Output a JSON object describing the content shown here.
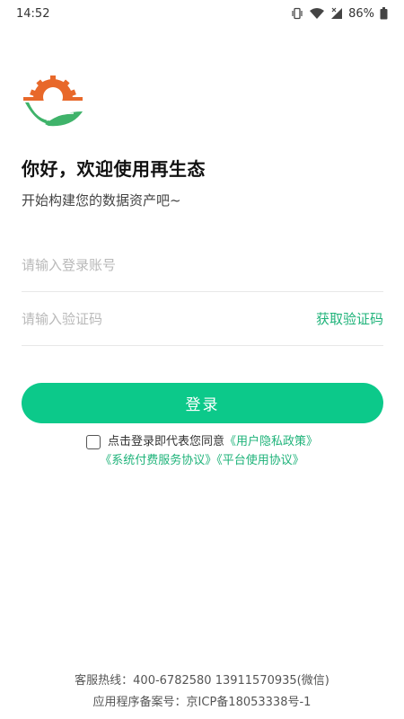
{
  "status_bar": {
    "time": "14:52",
    "battery": "86%"
  },
  "icons": {
    "vibrate": "vibrate-icon",
    "wifi": "wifi-icon",
    "signal": "signal-icon",
    "battery": "battery-icon",
    "logo": "sun-leaf-logo"
  },
  "colors": {
    "accent": "#0cc98a",
    "link": "#1fb37a",
    "logo_orange": "#e8682a",
    "logo_green": "#3fb36a"
  },
  "header": {
    "title": "你好，欢迎使用再生态",
    "subtitle": "开始构建您的数据资产吧~"
  },
  "form": {
    "account_placeholder": "请输入登录账号",
    "account_value": "",
    "code_placeholder": "请输入验证码",
    "code_value": "",
    "get_code_label": "获取验证码",
    "login_label": "登录"
  },
  "agreement": {
    "checked": false,
    "prefix": "点击登录即代表您同意",
    "privacy_link": "《用户隐私政策》",
    "payment_link": "《系统付费服务协议》",
    "platform_link": "《平台使用协议》"
  },
  "footer": {
    "hotline": "客服热线：400-6782580 13911570935(微信)",
    "icp": "应用程序备案号：京ICP备18053338号-1"
  }
}
